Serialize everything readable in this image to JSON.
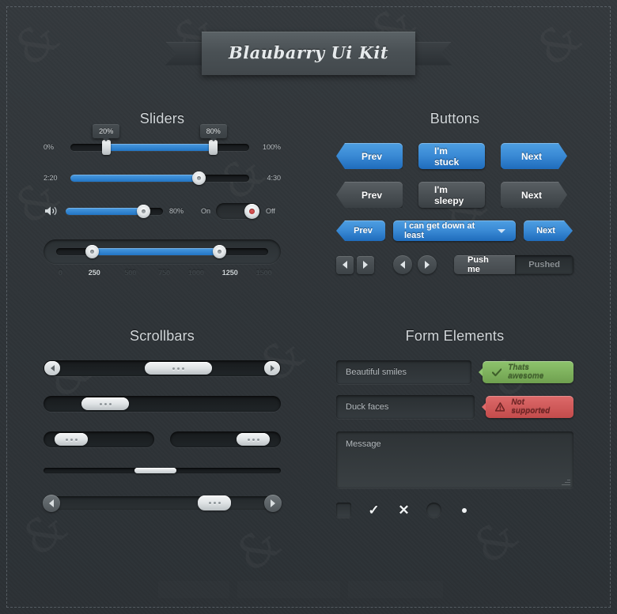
{
  "title": "Blaubarry Ui Kit",
  "sections": {
    "sliders": "Sliders",
    "buttons": "Buttons",
    "scrollbars": "Scrollbars",
    "form": "Form Elements"
  },
  "sliders": {
    "range": {
      "min_label": "0%",
      "max_label": "100%",
      "low_tooltip": "20%",
      "high_tooltip": "80%",
      "low_value": 20,
      "high_value": 80
    },
    "time": {
      "min_label": "2:20",
      "max_label": "4:30",
      "value": 72
    },
    "volume": {
      "icon": "speaker-icon",
      "value_label": "80%",
      "value": 80
    },
    "toggle": {
      "on_label": "On",
      "off_label": "Off",
      "state": "off"
    },
    "ticked": {
      "low_value": 250,
      "high_value": 1250,
      "ticks": [
        {
          "label": "0",
          "active": false
        },
        {
          "label": "250",
          "active": true
        },
        {
          "label": "500",
          "active": false
        },
        {
          "label": "750",
          "active": false
        },
        {
          "label": "1000",
          "active": false
        },
        {
          "label": "1250",
          "active": true
        },
        {
          "label": "1500",
          "active": false
        }
      ]
    }
  },
  "buttons": {
    "row_blue": {
      "prev": "Prev",
      "middle": "I'm stuck",
      "next": "Next"
    },
    "row_grey": {
      "prev": "Prev",
      "middle": "I'm sleepy",
      "next": "Next"
    },
    "row_dropdown": {
      "prev": "Prev",
      "select": "I can get down at least",
      "next": "Next",
      "caret_icon": "chevron-down-icon"
    },
    "nav": {
      "square_left_icon": "arrow-left-icon",
      "square_right_icon": "arrow-right-icon",
      "round_left_icon": "arrow-left-icon",
      "round_right_icon": "arrow-right-icon"
    },
    "segmented": {
      "active": "Push me",
      "inactive": "Pushed"
    }
  },
  "scrollbars": {
    "bar1": {
      "left_arrow_icon": "arrow-left-icon",
      "right_arrow_icon": "arrow-right-icon",
      "thumb_grip": "grip-dots"
    },
    "bar2": {
      "thumb_grip": "grip-dots"
    },
    "bar3_left": {
      "thumb_grip": "grip-dots"
    },
    "bar3_right": {
      "thumb_grip": "grip-dots"
    },
    "bar4": {
      "style": "thin"
    },
    "bar5": {
      "left_arrow_icon": "arrow-left-icon",
      "right_arrow_icon": "arrow-right-icon",
      "thumb_grip": "grip-dots"
    }
  },
  "form": {
    "input_1": {
      "value": "Beautiful smiles",
      "badge": {
        "text": "Thats awesome",
        "icon": "check-icon",
        "color": "#7fb35e"
      }
    },
    "input_2": {
      "value": "Duck faces",
      "badge": {
        "text": "Not supported",
        "icon": "warning-icon",
        "color": "#cf5b5b"
      }
    },
    "textarea": {
      "placeholder": "Message"
    },
    "controls": {
      "checkbox_empty": "",
      "checkbox_check": "✓",
      "checkbox_cross": "✕",
      "radio_empty": "",
      "radio_selected": "selected"
    }
  },
  "colors": {
    "accent_blue": "#3a8ad5",
    "background": "#31363a",
    "success": "#7fb35e",
    "danger": "#cf5b5b"
  }
}
